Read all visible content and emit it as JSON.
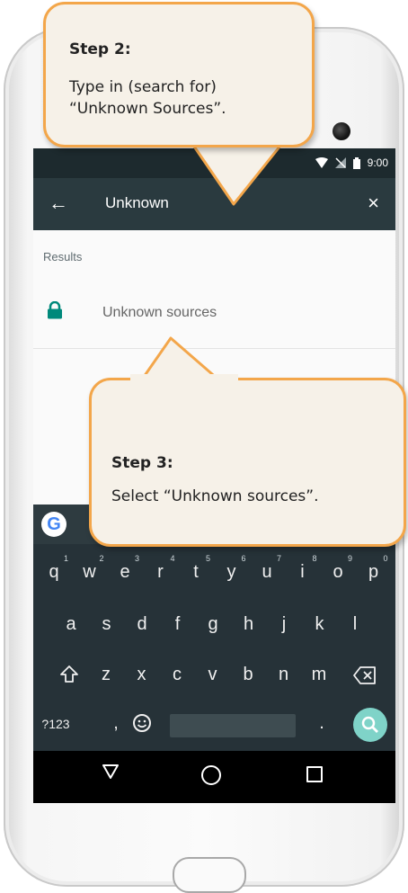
{
  "statusbar": {
    "time": "9:00"
  },
  "appbar": {
    "back_icon": "←",
    "query": "Unknown",
    "clear_icon": "×"
  },
  "results": {
    "section_label": "Results",
    "items": [
      {
        "label": "Unknown sources",
        "icon": "lock-icon"
      }
    ]
  },
  "keyboard": {
    "row1": [
      "q",
      "w",
      "e",
      "r",
      "t",
      "y",
      "u",
      "i",
      "o",
      "p"
    ],
    "row1_hints": [
      "1",
      "2",
      "3",
      "4",
      "5",
      "6",
      "7",
      "8",
      "9",
      "0"
    ],
    "row2": [
      "a",
      "s",
      "d",
      "f",
      "g",
      "h",
      "j",
      "k",
      "l"
    ],
    "row3": [
      "z",
      "x",
      "c",
      "v",
      "b",
      "n",
      "m"
    ],
    "symbols_key": "?123",
    "comma_key": ",",
    "period_key": ".",
    "google_logo": "G"
  },
  "callouts": {
    "step2": {
      "title": "Step 2:",
      "line1": "Type in (search for)",
      "line2": "“Unknown Sources”."
    },
    "step3": {
      "title": "Step 3:",
      "body": "Select “Unknown sources”."
    }
  },
  "colors": {
    "accent": "#f3a64a",
    "appbar": "#2a3a3f",
    "keyboard": "#263238",
    "lock": "#00897b",
    "search_fab": "#7fd3c8"
  }
}
